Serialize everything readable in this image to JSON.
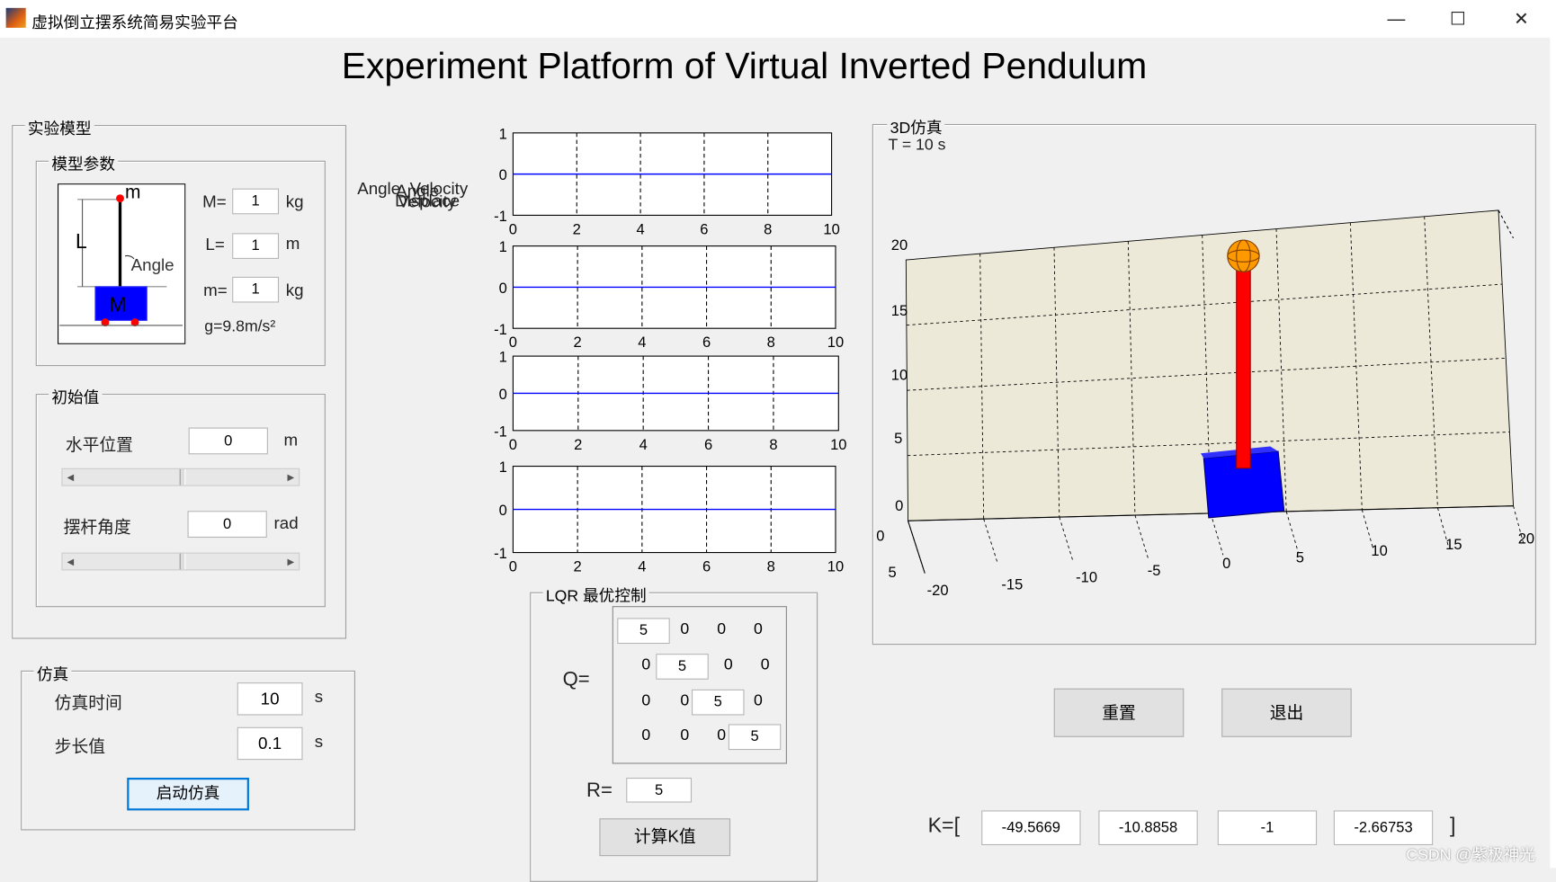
{
  "window": {
    "title": "虚拟倒立摆系统简易实验平台",
    "minimize": "—",
    "maximize": "☐",
    "close": "✕"
  },
  "main_title": "Experiment Platform of Virtual Inverted Pendulum",
  "model": {
    "group": "实验模型",
    "params_group": "模型参数",
    "M_label": "M=",
    "M": "1",
    "M_unit": "kg",
    "L_label": "L=",
    "L": "1",
    "L_unit": "m",
    "m_label": "m=",
    "m": "1",
    "m_unit": "kg",
    "g": "g=9.8m/s²",
    "diagram": {
      "m": "m",
      "L": "L",
      "angle": "Angle",
      "M": "M"
    }
  },
  "initial": {
    "group": "初始值",
    "pos_label": "水平位置",
    "pos": "0",
    "pos_unit": "m",
    "pos_slider": 0.5,
    "angle_label": "摆杆角度",
    "angle": "0",
    "angle_unit": "rad",
    "angle_slider": 0.5
  },
  "sim": {
    "group": "仿真",
    "time_label": "仿真时间",
    "time": "10",
    "time_unit": "s",
    "step_label": "步长值",
    "step": "0.1",
    "step_unit": "s",
    "start": "启动仿真"
  },
  "plots": [
    {
      "ylabel": "Angle",
      "xticks": [
        "0",
        "2",
        "4",
        "6",
        "8",
        "10"
      ],
      "yticks": [
        "1",
        "0",
        "-1"
      ],
      "value": 0
    },
    {
      "ylabel": "Angle_Velocity",
      "xticks": [
        "0",
        "2",
        "4",
        "6",
        "8",
        "10"
      ],
      "yticks": [
        "1",
        "0",
        "-1"
      ],
      "value": 0
    },
    {
      "ylabel": "Displace",
      "xticks": [
        "0",
        "2",
        "4",
        "6",
        "8",
        "10"
      ],
      "yticks": [
        "1",
        "0",
        "-1"
      ],
      "value": 0
    },
    {
      "ylabel": "Velocity",
      "xticks": [
        "0",
        "2",
        "4",
        "6",
        "8",
        "10"
      ],
      "yticks": [
        "1",
        "0",
        "-1"
      ],
      "value": 0
    }
  ],
  "lqr": {
    "group": "LQR 最优控制",
    "Q_label": "Q=",
    "Q": [
      [
        "5",
        "0",
        "0",
        "0"
      ],
      [
        "0",
        "5",
        "0",
        "0"
      ],
      [
        "0",
        "0",
        "5",
        "0"
      ],
      [
        "0",
        "0",
        "0",
        "5"
      ]
    ],
    "R_label": "R=",
    "R": "5",
    "compute": "计算K值"
  },
  "sim3d": {
    "group": "3D仿真",
    "time": "T = 10 s",
    "zticks": [
      "20",
      "15",
      "10",
      "5",
      "0"
    ],
    "xticks": [
      "-20",
      "-15",
      "-10",
      "-5",
      "0",
      "5",
      "10",
      "15",
      "20"
    ],
    "yticks": [
      "0",
      "5"
    ]
  },
  "buttons": {
    "reset": "重置",
    "exit": "退出"
  },
  "K": {
    "open": "K=[",
    "values": [
      "-49.5669",
      "-10.8858",
      "-1",
      "-2.66753"
    ],
    "close": "]"
  },
  "watermark": "CSDN @紫极神光",
  "colors": {
    "plot_line": "#0000ff",
    "cart": "#0000ff",
    "rod": "#ff0000",
    "ball": "#ff9900"
  }
}
